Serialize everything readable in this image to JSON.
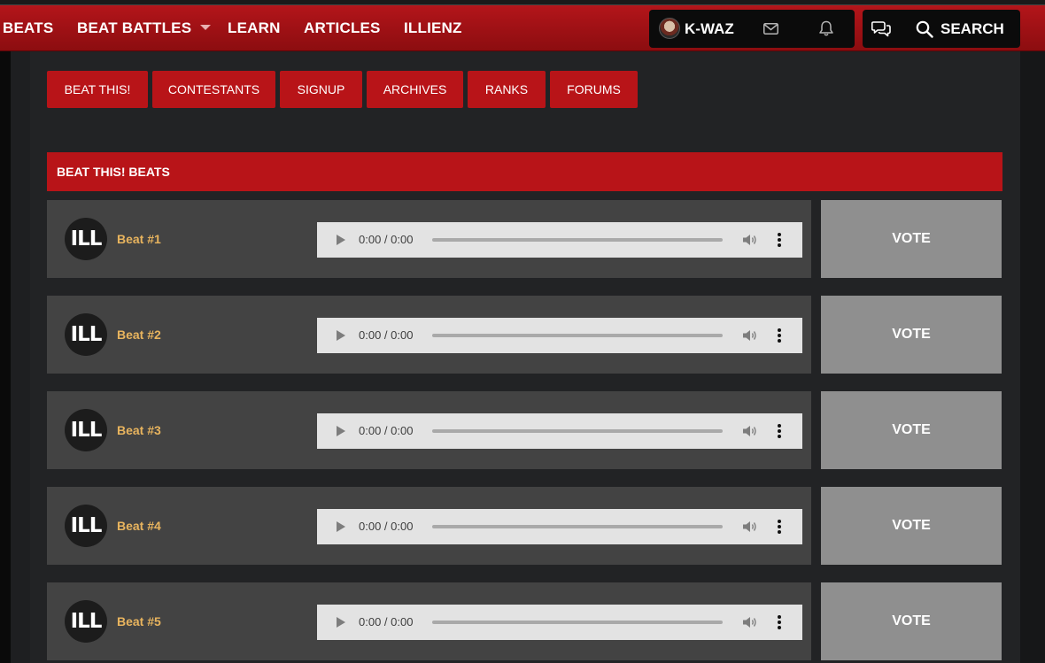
{
  "nav": {
    "items": [
      "BEATS",
      "BEAT BATTLES",
      "LEARN",
      "ARTICLES",
      "ILLIENZ"
    ],
    "username": "K-WAZ",
    "search_label": "SEARCH"
  },
  "subnav": [
    "BEAT THIS!",
    "CONTESTANTS",
    "SIGNUP",
    "ARCHIVES",
    "RANKS",
    "FORUMS"
  ],
  "section": {
    "title": "BEAT THIS! BEATS"
  },
  "beats": [
    {
      "logo": "ILL",
      "title": "Beat #1",
      "time": "0:00 / 0:00",
      "vote": "VOTE"
    },
    {
      "logo": "ILL",
      "title": "Beat #2",
      "time": "0:00 / 0:00",
      "vote": "VOTE"
    },
    {
      "logo": "ILL",
      "title": "Beat #3",
      "time": "0:00 / 0:00",
      "vote": "VOTE"
    },
    {
      "logo": "ILL",
      "title": "Beat #4",
      "time": "0:00 / 0:00",
      "vote": "VOTE"
    },
    {
      "logo": "ILL",
      "title": "Beat #5",
      "time": "0:00 / 0:00",
      "vote": "VOTE"
    }
  ],
  "colors": {
    "brand_red": "#b81418",
    "beat_title": "#e8b45e",
    "vote_bg": "#8f8f8f",
    "row_bg": "#434343"
  }
}
